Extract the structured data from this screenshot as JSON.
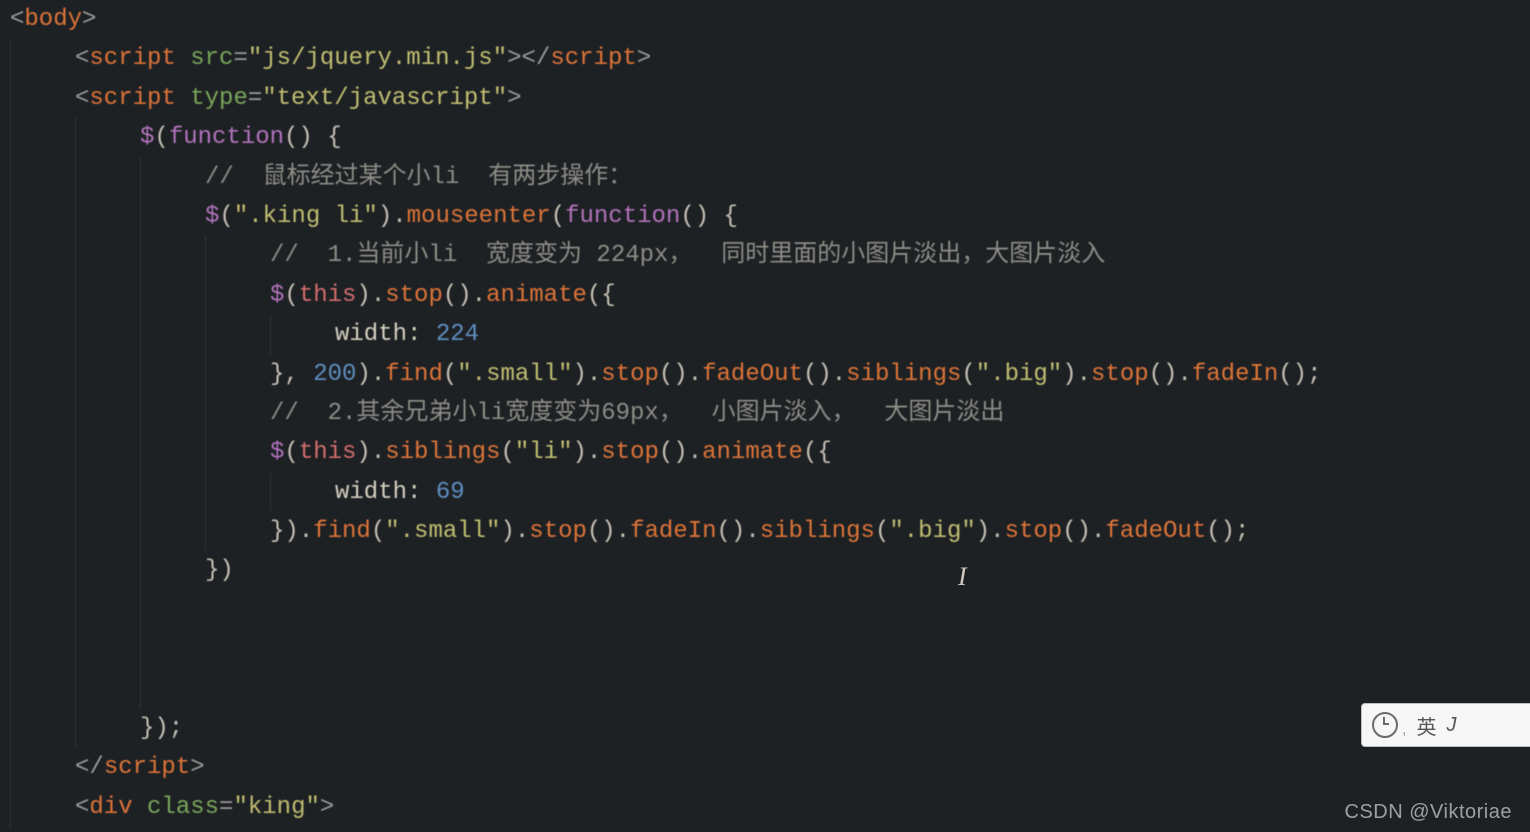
{
  "watermark": "CSDN @Viktoriae",
  "ime": {
    "label": "英",
    "suffix": "J"
  },
  "code": {
    "lines": [
      {
        "indent": 0,
        "html": "<span class='t-punc'>&lt;</span><span class='t-tag'>body</span><span class='t-punc'>&gt;</span>"
      },
      {
        "indent": 1,
        "html": "<span class='t-punc'>&lt;</span><span class='t-tag'>script</span> <span class='t-attr'>src</span><span class='t-punc'>=</span><span class='t-str'>\"js/jquery.min.js\"</span><span class='t-punc'>&gt;&lt;/</span><span class='t-tag'>script</span><span class='t-punc'>&gt;</span>"
      },
      {
        "indent": 1,
        "html": "<span class='t-punc'>&lt;</span><span class='t-tag'>script</span> <span class='t-attr'>type</span><span class='t-punc'>=</span><span class='t-str'>\"text/javascript\"</span><span class='t-punc'>&gt;</span>"
      },
      {
        "indent": 2,
        "html": "<span class='t-dollar'>$</span><span class='t-punc2'>(</span><span class='t-fn'>function</span><span class='t-punc2'>()</span> <span class='t-punc2'>{</span>"
      },
      {
        "indent": 3,
        "html": "<span class='t-cmt'>// &nbsp;鼠标经过某个小li &nbsp;有两步操作：</span>"
      },
      {
        "indent": 3,
        "html": "<span class='t-dollar'>$</span><span class='t-punc2'>(</span><span class='t-str'>\".king li\"</span><span class='t-punc2'>).</span><span class='t-tag'>mouseenter</span><span class='t-punc2'>(</span><span class='t-fn'>function</span><span class='t-punc2'>()</span> <span class='t-punc2'>{</span>"
      },
      {
        "indent": 4,
        "html": "<span class='t-cmt'>// &nbsp;1.当前小li &nbsp;宽度变为 224px， &nbsp;同时里面的小图片淡出，大图片淡入</span>"
      },
      {
        "indent": 4,
        "html": "<span class='t-dollar'>$</span><span class='t-punc2'>(</span><span class='t-this'>this</span><span class='t-punc2'>).</span><span class='t-tag'>stop</span><span class='t-punc2'>().</span><span class='t-tag'>animate</span><span class='t-punc2'>({</span>"
      },
      {
        "indent": 5,
        "html": "<span class='t-plain'>width:</span> <span class='t-num'>224</span>"
      },
      {
        "indent": 4,
        "html": "<span class='t-punc2'>},</span> <span class='t-num'>200</span><span class='t-punc2'>).</span><span class='t-tag'>find</span><span class='t-punc2'>(</span><span class='t-str'>\".small\"</span><span class='t-punc2'>).</span><span class='t-tag'>stop</span><span class='t-punc2'>().</span><span class='t-tag'>fadeOut</span><span class='t-punc2'>().</span><span class='t-tag'>siblings</span><span class='t-punc2'>(</span><span class='t-str'>\".big\"</span><span class='t-punc2'>).</span><span class='t-tag'>stop</span><span class='t-punc2'>().</span><span class='t-tag'>fadeIn</span><span class='t-punc2'>();</span>"
      },
      {
        "indent": 4,
        "html": "<span class='t-cmt'>// &nbsp;2.其余兄弟小li宽度变为69px， &nbsp;小图片淡入， &nbsp;大图片淡出</span>"
      },
      {
        "indent": 4,
        "html": "<span class='t-dollar'>$</span><span class='t-punc2'>(</span><span class='t-this'>this</span><span class='t-punc2'>).</span><span class='t-tag'>siblings</span><span class='t-punc2'>(</span><span class='t-str'>\"li\"</span><span class='t-punc2'>).</span><span class='t-tag'>stop</span><span class='t-punc2'>().</span><span class='t-tag'>animate</span><span class='t-punc2'>({</span>"
      },
      {
        "indent": 5,
        "html": "<span class='t-plain'>width:</span> <span class='t-num'>69</span>"
      },
      {
        "indent": 4,
        "html": "<span class='t-punc2'>}).</span><span class='t-tag'>find</span><span class='t-punc2'>(</span><span class='t-str'>\".small\"</span><span class='t-punc2'>).</span><span class='t-tag'>stop</span><span class='t-punc2'>().</span><span class='t-tag'>fadeIn</span><span class='t-punc2'>().</span><span class='t-tag'>siblings</span><span class='t-punc2'>(</span><span class='t-str'>\".big\"</span><span class='t-punc2'>).</span><span class='t-tag'>stop</span><span class='t-punc2'>().</span><span class='t-tag'>fadeOut</span><span class='t-punc2'>();</span>"
      },
      {
        "indent": 3,
        "html": "<span class='t-punc2'>})</span>"
      },
      {
        "indent": 3,
        "html": ""
      },
      {
        "indent": 3,
        "html": ""
      },
      {
        "indent": 3,
        "html": ""
      },
      {
        "indent": 2,
        "html": "<span class='t-punc2'>});</span>"
      },
      {
        "indent": 1,
        "html": "<span class='t-punc'>&lt;/</span><span class='t-tag'>script</span><span class='t-punc'>&gt;</span>"
      },
      {
        "indent": 1,
        "html": "<span class='t-punc'>&lt;</span><span class='t-tag'>div</span> <span class='t-attr'>class</span><span class='t-punc'>=</span><span class='t-str'>\"king\"</span><span class='t-punc'>&gt;</span>"
      }
    ]
  }
}
